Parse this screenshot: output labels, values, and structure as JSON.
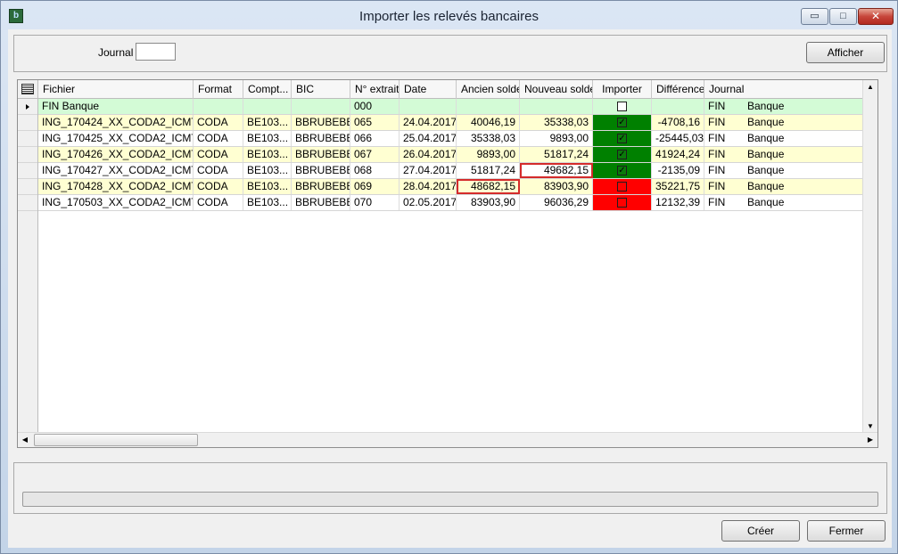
{
  "window": {
    "title": "Importer les relevés bancaires",
    "app_icon_text": "b",
    "minimize_glyph": "▭",
    "maximize_glyph": "□",
    "close_glyph": "✕"
  },
  "filter": {
    "journal_label": "Journal",
    "journal_value": "",
    "afficher_label": "Afficher"
  },
  "grid": {
    "columns": [
      "Fichier",
      "Format",
      "Compt...",
      "BIC",
      "N° extrait",
      "Date",
      "Ancien solde",
      "Nouveau solde",
      "Importer",
      "Différence",
      "Journal"
    ],
    "rows": [
      {
        "fichier": "FIN   Banque",
        "format": "",
        "compte": "",
        "bic": "",
        "extrait": "000",
        "date": "",
        "ancien": "",
        "nouveau": "",
        "importer": "unchecked",
        "difference": "",
        "journal": "FIN",
        "journal_name": "Banque"
      },
      {
        "fichier": "ING_170424_XX_CODA2_ICMT...",
        "format": "CODA",
        "compte": "BE103...",
        "bic": "BBRUBEBB",
        "extrait": "065",
        "date": "24.04.2017",
        "ancien": "40046,19",
        "nouveau": "35338,03",
        "importer": "checked",
        "difference": "-4708,16",
        "journal": "FIN",
        "journal_name": "Banque"
      },
      {
        "fichier": "ING_170425_XX_CODA2_ICMT...",
        "format": "CODA",
        "compte": "BE103...",
        "bic": "BBRUBEBB",
        "extrait": "066",
        "date": "25.04.2017",
        "ancien": "35338,03",
        "nouveau": "9893,00",
        "importer": "checked",
        "difference": "-25445,03",
        "journal": "FIN",
        "journal_name": "Banque"
      },
      {
        "fichier": "ING_170426_XX_CODA2_ICMT...",
        "format": "CODA",
        "compte": "BE103...",
        "bic": "BBRUBEBB",
        "extrait": "067",
        "date": "26.04.2017",
        "ancien": "9893,00",
        "nouveau": "51817,24",
        "importer": "checked",
        "difference": "41924,24",
        "journal": "FIN",
        "journal_name": "Banque"
      },
      {
        "fichier": "ING_170427_XX_CODA2_ICMT...",
        "format": "CODA",
        "compte": "BE103...",
        "bic": "BBRUBEBB",
        "extrait": "068",
        "date": "27.04.2017",
        "ancien": "51817,24",
        "nouveau": "49682,15",
        "importer": "checked",
        "difference": "-2135,09",
        "journal": "FIN",
        "journal_name": "Banque"
      },
      {
        "fichier": "ING_170428_XX_CODA2_ICMT...",
        "format": "CODA",
        "compte": "BE103...",
        "bic": "BBRUBEBB",
        "extrait": "069",
        "date": "28.04.2017",
        "ancien": "48682,15",
        "nouveau": "83903,90",
        "importer": "error",
        "difference": "35221,75",
        "journal": "FIN",
        "journal_name": "Banque"
      },
      {
        "fichier": "ING_170503_XX_CODA2_ICMT...",
        "format": "CODA",
        "compte": "BE103...",
        "bic": "BBRUBEBB",
        "extrait": "070",
        "date": "02.05.2017",
        "ancien": "83903,90",
        "nouveau": "96036,29",
        "importer": "error",
        "difference": "12132,39",
        "journal": "FIN",
        "journal_name": "Banque"
      }
    ],
    "scroll_up_glyph": "▲",
    "scroll_down_glyph": "▼",
    "scroll_left_glyph": "◀",
    "scroll_right_glyph": "▶",
    "check_glyph": "✓"
  },
  "colors": {
    "row_header_green": "#d3fbd6",
    "row_yellow": "#ffffd2",
    "import_ok": "#008000",
    "import_error": "#ff0000",
    "highlight_border": "#d42b2b"
  },
  "footer": {
    "creer_label": "Créer",
    "fermer_label": "Fermer"
  }
}
